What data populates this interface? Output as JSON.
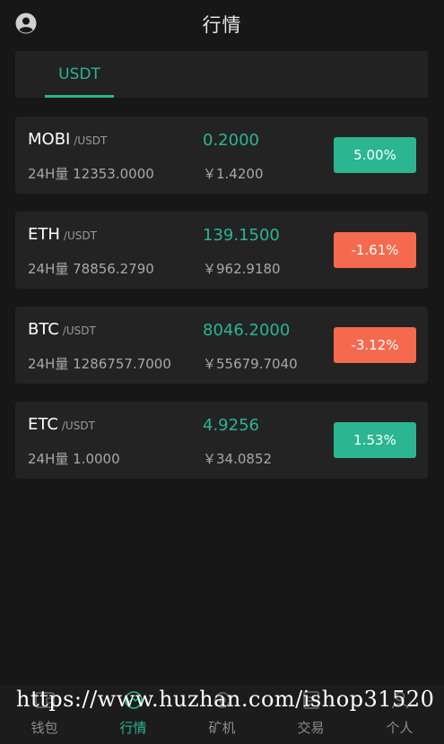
{
  "header": {
    "title": "行情",
    "avatar_icon": "user-avatar-icon"
  },
  "tabs": [
    {
      "label": "USDT",
      "active": true
    }
  ],
  "markets": [
    {
      "symbol": "MOBI",
      "pair": "/USDT",
      "volume": "24H量 12353.0000",
      "price": "0.2000",
      "cny": "￥1.4200",
      "change": "5.00%",
      "direction": "up"
    },
    {
      "symbol": "ETH",
      "pair": "/USDT",
      "volume": "24H量 78856.2790",
      "price": "139.1500",
      "cny": "￥962.9180",
      "change": "-1.61%",
      "direction": "down"
    },
    {
      "symbol": "BTC",
      "pair": "/USDT",
      "volume": "24H量 1286757.7000",
      "price": "8046.2000",
      "cny": "￥55679.7040",
      "change": "-3.12%",
      "direction": "down"
    },
    {
      "symbol": "ETC",
      "pair": "/USDT",
      "volume": "24H量 1.0000",
      "price": "4.9256",
      "cny": "￥34.0852",
      "change": "1.53%",
      "direction": "up"
    }
  ],
  "tabbar": [
    {
      "label": "钱包",
      "icon": "wallet-icon",
      "active": false
    },
    {
      "label": "行情",
      "icon": "market-icon",
      "active": true
    },
    {
      "label": "矿机",
      "icon": "miner-icon",
      "active": false
    },
    {
      "label": "交易",
      "icon": "trade-icon",
      "active": false
    },
    {
      "label": "个人",
      "icon": "profile-icon",
      "active": false
    }
  ],
  "watermark": "https://www.huzhan.com/ishop31520",
  "colors": {
    "accent": "#2bb591",
    "down": "#f56a4e",
    "background": "#171717",
    "card": "#232323"
  }
}
